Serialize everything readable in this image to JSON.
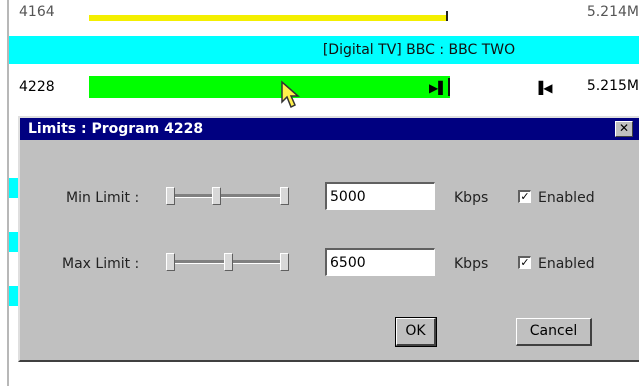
{
  "rows": {
    "top": {
      "program": "4164",
      "rate": "5.214M",
      "bar_color": "#f4ef00"
    },
    "channel": {
      "label": "[Digital TV] BBC : BBC TWO",
      "color": "#00ffff"
    },
    "selected": {
      "program": "4228",
      "rate": "5.215M",
      "bar_color": "#00ff00",
      "marker_right": "▶▌",
      "marker_left": "▐◀"
    }
  },
  "dialog": {
    "title": "Limits : Program 4228",
    "close_label": "✕",
    "min": {
      "label": "Min Limit :",
      "value": "5000",
      "unit": "Kbps",
      "enabled_label": "Enabled",
      "enabled": true
    },
    "max": {
      "label": "Max Limit :",
      "value": "6500",
      "unit": "Kbps",
      "enabled_label": "Enabled",
      "enabled": true
    },
    "ok_label": "OK",
    "cancel_label": "Cancel",
    "titlebar_color": "#000080"
  }
}
